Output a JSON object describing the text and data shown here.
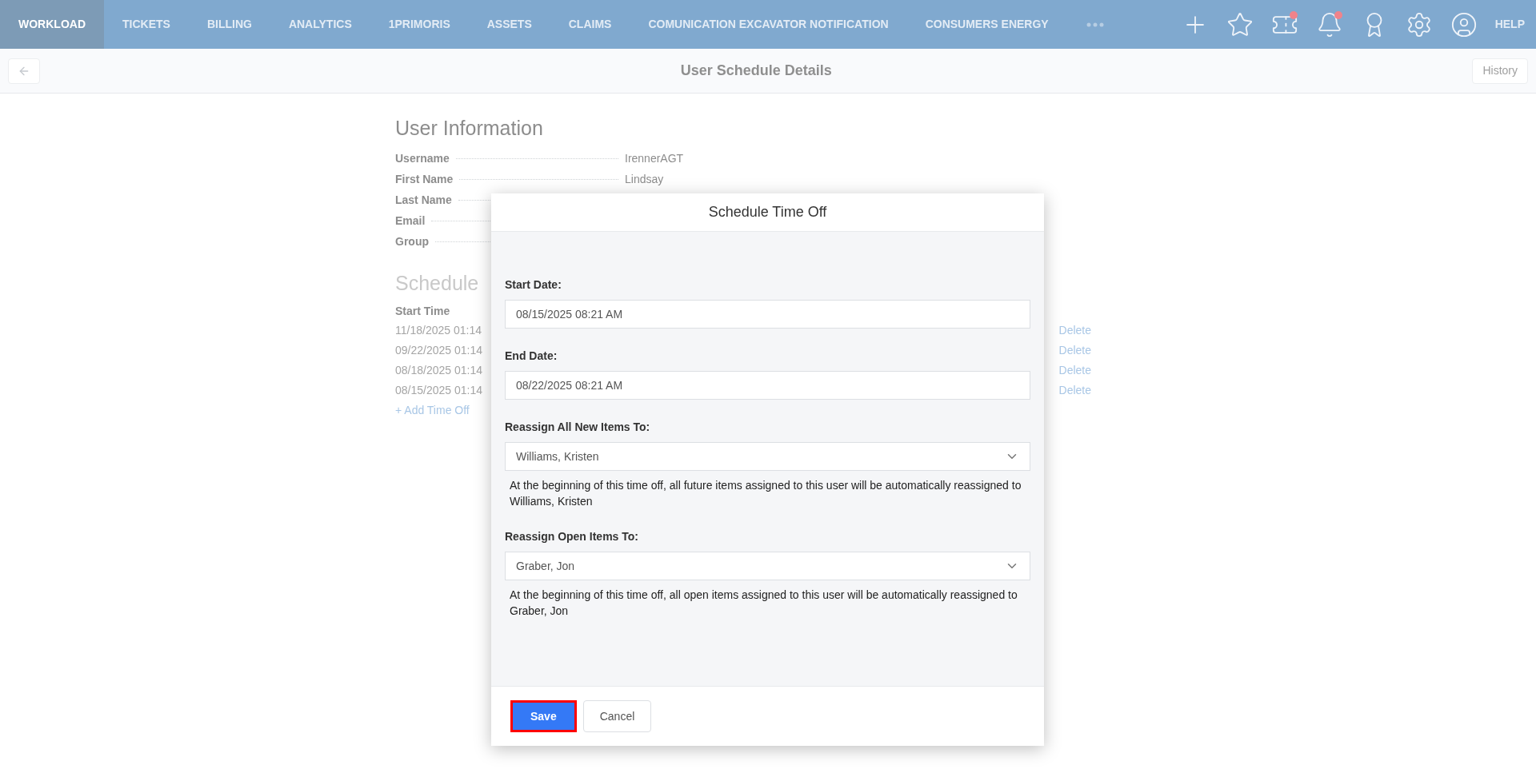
{
  "nav": {
    "items": [
      {
        "label": "WORKLOAD",
        "selected": true
      },
      {
        "label": "TICKETS",
        "selected": false
      },
      {
        "label": "BILLING",
        "selected": false
      },
      {
        "label": "ANALYTICS",
        "selected": false
      },
      {
        "label": "1PRIMORIS",
        "selected": false
      },
      {
        "label": "ASSETS",
        "selected": false
      },
      {
        "label": "CLAIMS",
        "selected": false
      },
      {
        "label": "COMUNICATION EXCAVATOR NOTIFICATION",
        "selected": false
      },
      {
        "label": "CONSUMERS ENERGY",
        "selected": false
      }
    ],
    "icons": [
      {
        "kind": "plus",
        "badge": false
      },
      {
        "kind": "star",
        "badge": false
      },
      {
        "kind": "ticket",
        "badge": true
      },
      {
        "kind": "bell",
        "badge": true
      },
      {
        "kind": "award",
        "badge": false
      },
      {
        "kind": "gear",
        "badge": false
      },
      {
        "kind": "user",
        "badge": false
      }
    ],
    "help": "HELP"
  },
  "header": {
    "title": "User Schedule Details",
    "history": "History"
  },
  "user_info": {
    "title": "User Information",
    "fields": [
      {
        "label": "Username",
        "value": "IrennerAGT"
      },
      {
        "label": "First Name",
        "value": "Lindsay"
      },
      {
        "label": "Last Name"
      },
      {
        "label": "Email"
      },
      {
        "label": "Group"
      }
    ]
  },
  "scheduled": {
    "title": "Schedule",
    "column": "Start Time",
    "rows": [
      {
        "start": "11/18/2025 01:14",
        "action": "Delete"
      },
      {
        "start": "09/22/2025 01:14",
        "action": "Delete"
      },
      {
        "start": "08/18/2025 01:14",
        "action": "Delete"
      },
      {
        "start": "08/15/2025 01:14",
        "action": "Delete"
      }
    ],
    "add": "+ Add Time Off"
  },
  "modal": {
    "title": "Schedule Time Off",
    "fields": [
      {
        "kind": "input",
        "label": "Start Date:",
        "value": "08/15/2025 08:21 AM"
      },
      {
        "kind": "input",
        "label": "End Date:",
        "value": "08/22/2025 08:21 AM"
      },
      {
        "kind": "select",
        "label": "Reassign All New Items To:",
        "value": "Williams, Kristen",
        "note": "At the beginning of this time off, all future items assigned to this user will be automatically reassigned to Williams, Kristen"
      },
      {
        "kind": "select",
        "label": "Reassign Open Items To:",
        "value": "Graber, Jon",
        "note": "At the beginning of this time off, all open items assigned to this user will be automatically reassigned to Graber, Jon"
      }
    ],
    "buttons": [
      {
        "kind": "primary",
        "label": "Save",
        "highlighted": true
      },
      {
        "kind": "secondary",
        "label": "Cancel",
        "highlighted": false
      }
    ]
  }
}
